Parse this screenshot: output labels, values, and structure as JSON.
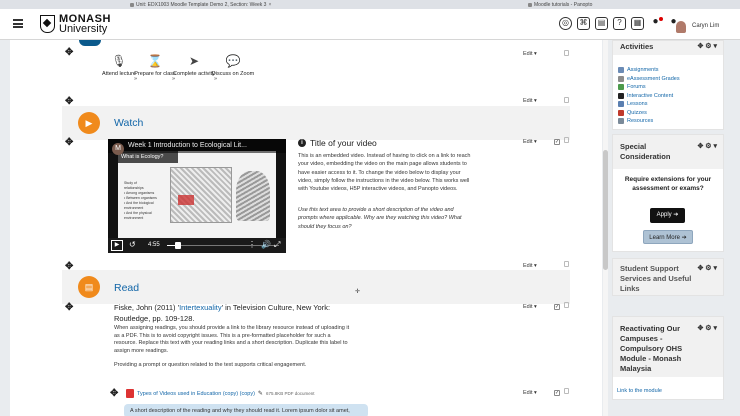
{
  "browser": {
    "tabs": [
      {
        "label": "Unit: EDX1003 Moodle Template Demo 2, Section: Week 3"
      },
      {
        "label": "Moodle tutorials - Panopto"
      }
    ]
  },
  "navbar": {
    "logo_line1": "MONASH",
    "logo_line2": "University",
    "user_name": "Caryn Lim"
  },
  "steps": [
    {
      "label": "Attend lecture",
      "icon": "microphone-icon"
    },
    {
      "label": "Prepare for class",
      "icon": "hourglass-icon"
    },
    {
      "label": "Complete activity",
      "icon": "cursor-icon"
    },
    {
      "label": "Discuss on Zoom",
      "icon": "chat-icon"
    }
  ],
  "edit_label": "Edit",
  "watch": {
    "title": "Watch",
    "video": {
      "channel_initial": "M",
      "title": "Week 1 Introduction to Ecological Lit...",
      "slide_heading": "What is Ecology?",
      "slide_lines": [
        "Study of",
        "relationships",
        "• Among organisms",
        "• Between organisms",
        "• And the biological",
        "  environment",
        "• And the physical",
        "  environment"
      ],
      "time": "4:55",
      "progress": 0.1
    },
    "video_heading": "Title of your video",
    "video_body": "This is an embedded video. Instead of having to click on a link to reach your video, embedding the video on the main page allows students to have easier access to it. To change the video below to display your video, simply follow the instructions in the video below. This works well with Youtube videos, H5P interactive videos, and Panopto videos.",
    "video_note": "Use this text area to provide a short description of the video and prompts where applicable. Why are they watching this video? What should they focus on?"
  },
  "read": {
    "title": "Read",
    "citation_pre": "Fiske, John (2011) '",
    "citation_link": "Intertexuality",
    "citation_post": "' in Television Culture, New York: Routledge, pp. 109-128.",
    "body1": "When assigning readings, you should provide a link to the library resource instead of uploading it as a PDF. This is to avoid copyright issues. This is a pre-formatted placeholder for such a resource. Replace this text with your reading links and a short description. Duplicate this label to assign more readings.",
    "body2": "Providing a prompt or question related to the text supports critical engagement.",
    "pdf_link": "Types of Videos used in Education (copy) (copy)",
    "pdf_size": "675.8KB PDF document",
    "pdf_desc": "A short description of the reading and why they should read it. Lorem ipsum dolor sit amet,"
  },
  "blocks": {
    "activities": {
      "title": "Activities",
      "items": [
        {
          "label": "Assignments",
          "color": "#6b8bb5"
        },
        {
          "label": "eAssessment Grades",
          "color": "#8c8c8c"
        },
        {
          "label": "Forums",
          "color": "#4c9a4c"
        },
        {
          "label": "Interactive Content",
          "color": "#222222"
        },
        {
          "label": "Lessons",
          "color": "#5a7fb0"
        },
        {
          "label": "Quizzes",
          "color": "#c0392b"
        },
        {
          "label": "Resources",
          "color": "#7a8a99"
        }
      ]
    },
    "special": {
      "title": "Special Consideration",
      "text": "Require extensions for your assessment or exams?",
      "apply_label": "Apply ➔",
      "learn_label": "Learn More ➔"
    },
    "support": {
      "title": "Student Support Services and Useful Links"
    },
    "campus": {
      "title": "Reactivating Our Campuses - Compulsory OHS Module - Monash Malaysia",
      "link": "Link to the module"
    }
  },
  "colors": {
    "accent": "#1266a8",
    "section_icon": "#f08a1c",
    "brand": "#0b5a8c"
  }
}
